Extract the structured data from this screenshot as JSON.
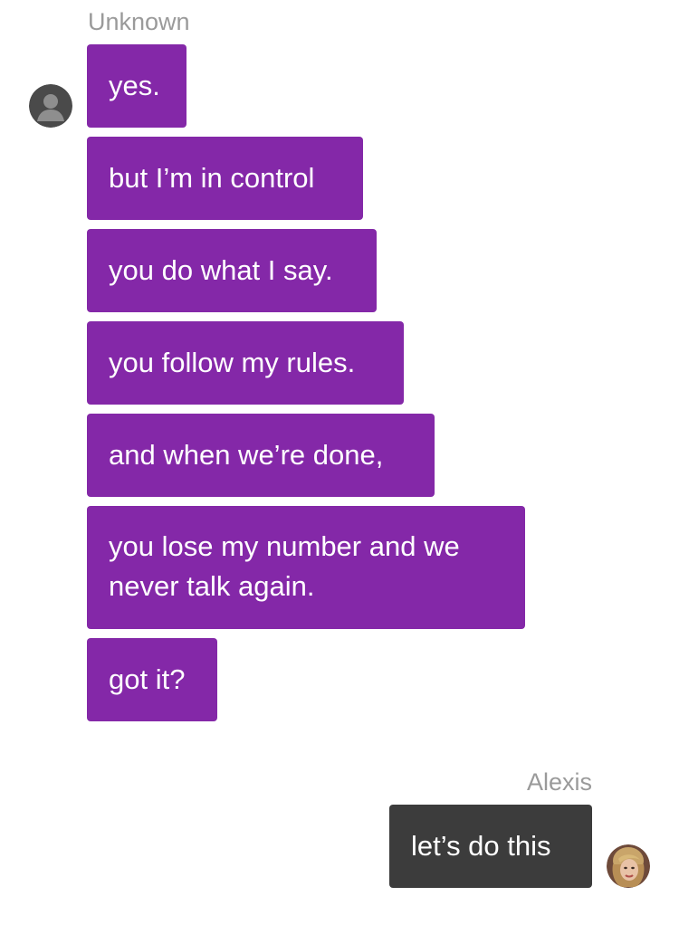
{
  "thread": {
    "incoming": {
      "sender_name": "Unknown",
      "avatar_icon": "default-user-icon",
      "bubble_color": "#8428a8",
      "messages": [
        "yes.",
        "but I’m in control",
        "you do what I say.",
        "you follow my rules.",
        "and when we’re done,",
        "you lose my number and we never talk again.",
        "got it?"
      ]
    },
    "outgoing": {
      "sender_name": "Alexis",
      "avatar_icon": "user-photo-icon",
      "bubble_color": "#3c3c3c",
      "messages": [
        "let’s do this"
      ]
    }
  }
}
